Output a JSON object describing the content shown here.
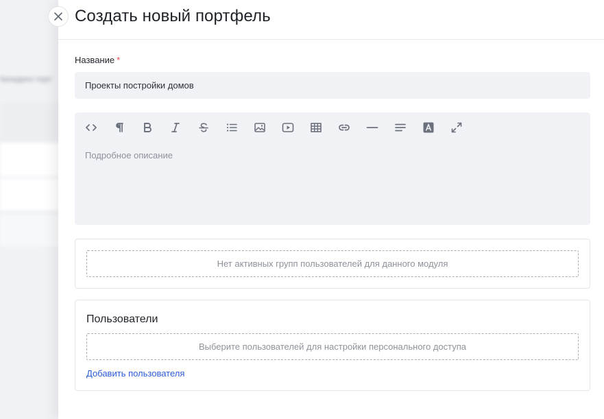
{
  "background": {
    "blurred_text": "Кенедино порт"
  },
  "header": {
    "title": "Создать новый портфель",
    "close_icon": "close-icon"
  },
  "form": {
    "name_label": "Название",
    "required_mark": "*",
    "name_value": "Проекты постройки домов",
    "description_placeholder": "Подробное описание"
  },
  "toolbar": {
    "items": [
      "code-icon",
      "paragraph-icon",
      "bold-icon",
      "italic-icon",
      "strikethrough-icon",
      "bullet-list-icon",
      "image-icon",
      "video-icon",
      "table-icon",
      "link-icon",
      "horizontal-rule-icon",
      "align-icon",
      "text-color-icon",
      "fullscreen-icon"
    ]
  },
  "groups": {
    "empty_text": "Нет активных групп пользователей для данного модуля"
  },
  "users": {
    "title": "Пользователи",
    "empty_text": "Выберите пользователей для настройки персонального доступа",
    "add_link": "Добавить пользователя"
  },
  "colors": {
    "accent": "#2a5bd7",
    "required": "#e5484d",
    "input_bg": "#f1f2f6"
  }
}
